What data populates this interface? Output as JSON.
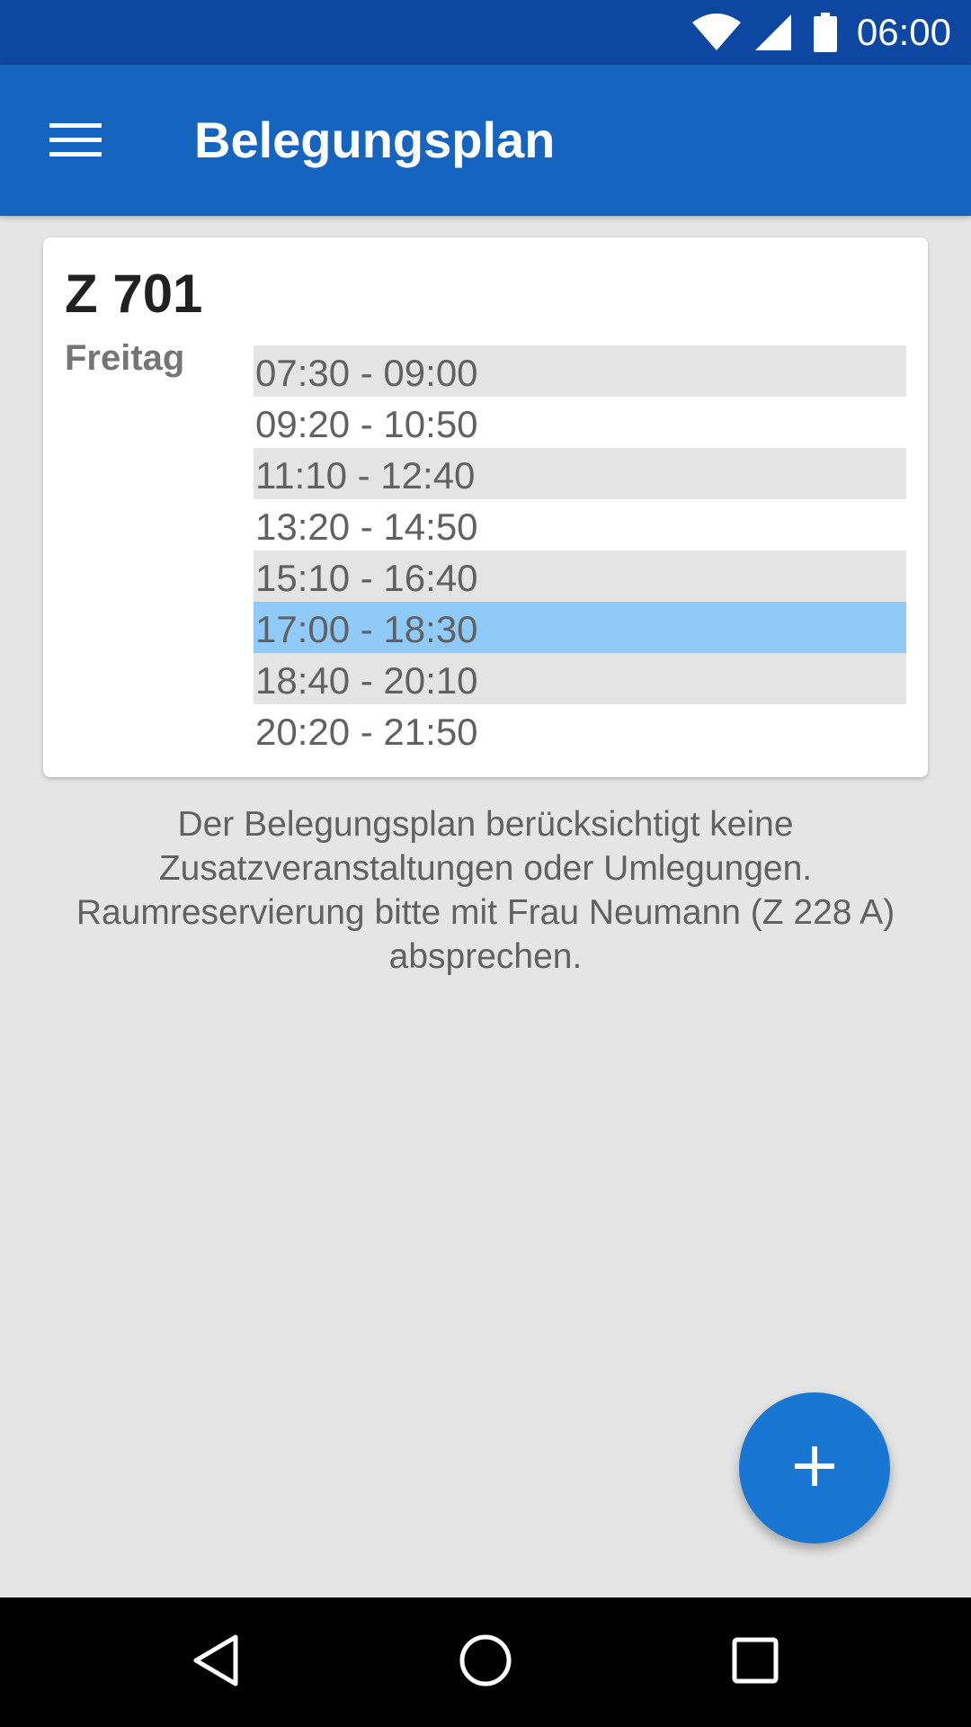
{
  "status_bar": {
    "time": "06:00",
    "icons": [
      "wifi-icon",
      "signal-icon",
      "battery-icon"
    ],
    "background": "#0d47a1"
  },
  "app_bar": {
    "title": "Belegungsplan",
    "menu_icon": "menu-icon",
    "background": "#1565c0"
  },
  "card": {
    "room": "Z 701",
    "day": "Freitag",
    "slots": [
      {
        "time": "07:30 - 09:00",
        "state": "shaded"
      },
      {
        "time": "09:20 - 10:50",
        "state": "plain"
      },
      {
        "time": "11:10 - 12:40",
        "state": "shaded"
      },
      {
        "time": "13:20 - 14:50",
        "state": "plain"
      },
      {
        "time": "15:10 - 16:40",
        "state": "shaded"
      },
      {
        "time": "17:00 - 18:30",
        "state": "active"
      },
      {
        "time": "18:40 - 20:10",
        "state": "shaded"
      },
      {
        "time": "20:20 - 21:50",
        "state": "plain"
      }
    ]
  },
  "notice": {
    "lines": [
      "Der Belegungsplan berücksichtigt keine",
      "Zusatzveranstaltungen oder Umlegungen.",
      "Raumreservierung bitte mit Frau Neumann (Z 228 A)",
      "absprechen."
    ]
  },
  "fab": {
    "icon": "plus-icon",
    "color": "#1976d2"
  },
  "nav_bar": {
    "buttons": [
      "back-icon",
      "home-icon",
      "recent-apps-icon"
    ]
  },
  "colors": {
    "active_slot": "#90caf9",
    "shaded_slot": "#e4e4e4",
    "page_background": "#e5e5e5"
  }
}
